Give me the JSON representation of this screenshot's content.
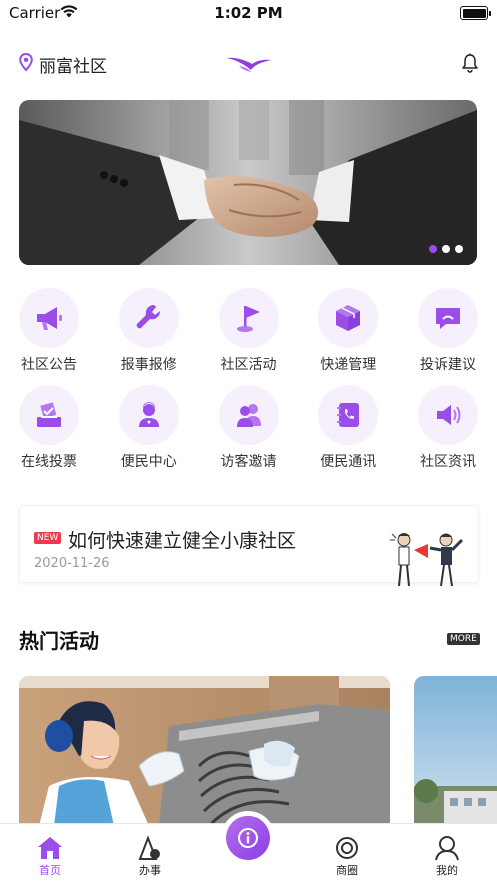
{
  "status_bar": {
    "carrier": "Carrier",
    "time": "1:02 PM"
  },
  "header": {
    "location": "丽富社区"
  },
  "banner": {
    "dots": 3,
    "active_dot": 0
  },
  "grid": {
    "rows": [
      [
        {
          "label": "社区公告",
          "icon": "megaphone-icon"
        },
        {
          "label": "报事报修",
          "icon": "wrench-icon"
        },
        {
          "label": "社区活动",
          "icon": "flag-icon"
        },
        {
          "label": "快递管理",
          "icon": "package-icon"
        },
        {
          "label": "投诉建议",
          "icon": "complaint-icon"
        }
      ],
      [
        {
          "label": "在线投票",
          "icon": "ballot-icon"
        },
        {
          "label": "便民中心",
          "icon": "service-person-icon"
        },
        {
          "label": "访客邀请",
          "icon": "visitors-icon"
        },
        {
          "label": "便民通讯",
          "icon": "phone-book-icon"
        },
        {
          "label": "社区资讯",
          "icon": "broadcast-icon"
        }
      ]
    ]
  },
  "news": {
    "tag": "NEW",
    "title": "如何快速建立健全小康社区",
    "date": "2020-11-26"
  },
  "hot": {
    "title": "热门活动",
    "more": "MORE"
  },
  "tabbar": {
    "tabs": [
      {
        "label": "首页",
        "icon": "home-icon",
        "active": true
      },
      {
        "label": "办事",
        "icon": "tasks-icon",
        "active": false
      },
      {
        "label": "商圈",
        "icon": "circle-icon",
        "active": false
      },
      {
        "label": "我的",
        "icon": "user-icon",
        "active": false
      }
    ]
  },
  "colors": {
    "accent": "#9b4dea",
    "tag_red": "#ee3b4b"
  }
}
